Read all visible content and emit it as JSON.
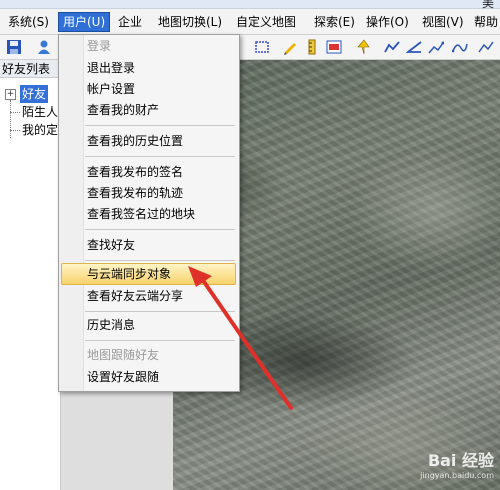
{
  "window": {
    "title_fragment": "美"
  },
  "menubar": {
    "items": [
      {
        "label": "系统(S)"
      },
      {
        "label": "用户(U)"
      },
      {
        "label": "企业"
      },
      {
        "label": "地图切换(L)"
      },
      {
        "label": "自定义地图"
      },
      {
        "label": "探索(E)"
      },
      {
        "label": "操作(O)"
      },
      {
        "label": "视图(V)"
      },
      {
        "label": "帮助"
      }
    ]
  },
  "left_panel": {
    "header": "好友列表",
    "tree": {
      "friends": "好友",
      "strangers": "陌生人",
      "mine": "我的定"
    }
  },
  "user_menu": {
    "items": [
      {
        "label": "登录",
        "enabled": false
      },
      {
        "label": "退出登录",
        "enabled": true
      },
      {
        "label": "帐户设置",
        "enabled": true
      },
      {
        "label": "查看我的财产",
        "enabled": true
      },
      {
        "label": "查看我的历史位置",
        "enabled": true
      },
      {
        "label": "查看我发布的签名",
        "enabled": true
      },
      {
        "label": "查看我发布的轨迹",
        "enabled": true
      },
      {
        "label": "查看我签名过的地块",
        "enabled": true
      },
      {
        "label": "查找好友",
        "enabled": true
      },
      {
        "label": "与云端同步对象",
        "enabled": true,
        "highlighted": true
      },
      {
        "label": "查看好友云端分享",
        "enabled": true
      },
      {
        "label": "历史消息",
        "enabled": true
      },
      {
        "label": "地图跟随好友",
        "enabled": false
      },
      {
        "label": "设置好友跟随",
        "enabled": true
      }
    ]
  },
  "watermark": {
    "brand": "Bai 经验",
    "sub": "jingyan.baidu.com"
  },
  "colors": {
    "menu_active": "#2f6fd6",
    "highlight": "#f7d36b",
    "annotation_arrow": "#e0302a"
  }
}
